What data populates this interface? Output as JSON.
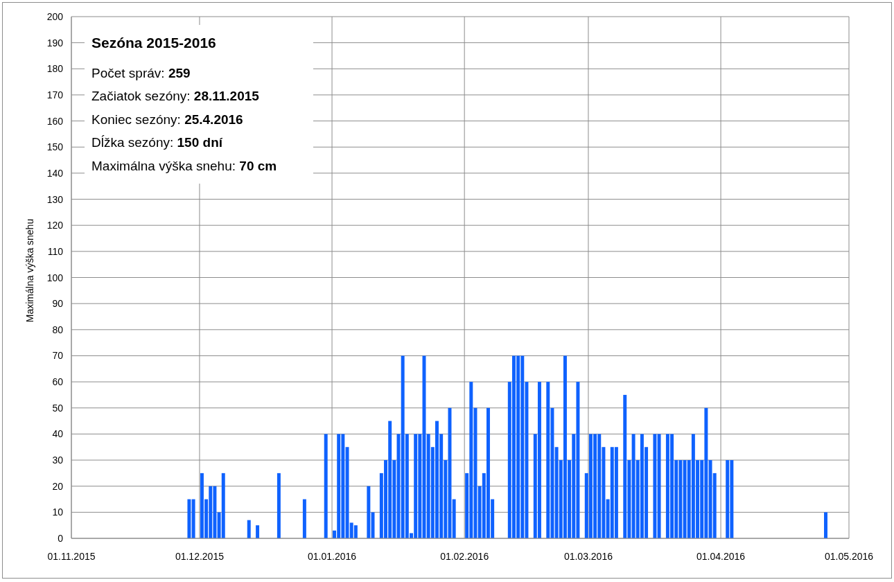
{
  "chart": {
    "info_box": {
      "title": "Sezóna 2015-2016",
      "lines": [
        "Počet správ: **259**",
        "Začiatok sezóny: **28.11.2015**",
        "Koniec sezóny: **25.4.2016**",
        "Dĺžka sezóny: **150 dní**",
        "Maximálna výška snehu: **70 cm**"
      ]
    },
    "chart_data": {
      "type": "bar",
      "grid": true,
      "ylabel": "Maximálna výška snehu",
      "ylim": [
        0,
        200
      ],
      "yticks": [
        0,
        10,
        20,
        30,
        40,
        50,
        60,
        70,
        80,
        90,
        100,
        110,
        120,
        130,
        140,
        150,
        160,
        170,
        180,
        190,
        200
      ],
      "categories": [
        "01.11.2015",
        null,
        null,
        null,
        null,
        null,
        null,
        null,
        null,
        null,
        null,
        null,
        null,
        null,
        null,
        null,
        null,
        null,
        null,
        null,
        null,
        null,
        null,
        null,
        null,
        null,
        null,
        null,
        null,
        null,
        "01.12.2015",
        null,
        null,
        null,
        null,
        null,
        null,
        null,
        null,
        null,
        null,
        null,
        null,
        null,
        null,
        null,
        null,
        null,
        null,
        null,
        null,
        null,
        null,
        null,
        null,
        null,
        null,
        null,
        null,
        null,
        null,
        "01.01.2016",
        null,
        null,
        null,
        null,
        null,
        null,
        null,
        null,
        null,
        null,
        null,
        null,
        null,
        null,
        null,
        null,
        null,
        null,
        null,
        null,
        null,
        null,
        null,
        null,
        null,
        null,
        null,
        null,
        null,
        null,
        "01.02.2016",
        null,
        null,
        null,
        null,
        null,
        null,
        null,
        null,
        null,
        null,
        null,
        null,
        null,
        null,
        null,
        null,
        null,
        null,
        null,
        null,
        null,
        null,
        null,
        null,
        null,
        null,
        null,
        null,
        "01.03.2016",
        null,
        null,
        null,
        null,
        null,
        null,
        null,
        null,
        null,
        null,
        null,
        null,
        null,
        null,
        null,
        null,
        null,
        null,
        null,
        null,
        null,
        null,
        null,
        null,
        null,
        null,
        null,
        null,
        null,
        null,
        "01.04.2016",
        null,
        null,
        null,
        null,
        null,
        null,
        null,
        null,
        null,
        null,
        null,
        null,
        null,
        null,
        null,
        null,
        null,
        null,
        null,
        null,
        null,
        null,
        null,
        null,
        null,
        null,
        null,
        null,
        null,
        "01.05.2016"
      ],
      "series": [
        {
          "color": "#0f62fe",
          "values": [
            null,
            null,
            null,
            null,
            null,
            null,
            null,
            null,
            null,
            null,
            null,
            null,
            null,
            null,
            null,
            null,
            null,
            null,
            null,
            null,
            null,
            null,
            null,
            null,
            null,
            null,
            null,
            15,
            15,
            null,
            25,
            15,
            20,
            20,
            10,
            25,
            null,
            null,
            null,
            null,
            null,
            7,
            null,
            5,
            null,
            null,
            null,
            null,
            25,
            null,
            null,
            null,
            null,
            null,
            15,
            null,
            null,
            null,
            null,
            40,
            null,
            3,
            40,
            40,
            35,
            6,
            5,
            null,
            null,
            20,
            10,
            null,
            25,
            30,
            45,
            30,
            40,
            70,
            40,
            2,
            40,
            40,
            70,
            40,
            35,
            45,
            40,
            30,
            50,
            15,
            null,
            null,
            25,
            60,
            50,
            20,
            25,
            50,
            15,
            null,
            null,
            null,
            60,
            70,
            70,
            70,
            60,
            null,
            40,
            60,
            null,
            60,
            50,
            35,
            30,
            70,
            30,
            40,
            60,
            null,
            25,
            40,
            40,
            40,
            35,
            15,
            35,
            35,
            null,
            55,
            30,
            40,
            30,
            40,
            35,
            null,
            40,
            40,
            null,
            40,
            40,
            30,
            30,
            30,
            30,
            40,
            30,
            30,
            50,
            30,
            25,
            null,
            null,
            30,
            30,
            null,
            null,
            null,
            null,
            null,
            null,
            null,
            null,
            null,
            null,
            null,
            null,
            null,
            null,
            null,
            null,
            null,
            null,
            null,
            null,
            null,
            10,
            null,
            null,
            null,
            null,
            null,
            null
          ]
        }
      ]
    }
  }
}
